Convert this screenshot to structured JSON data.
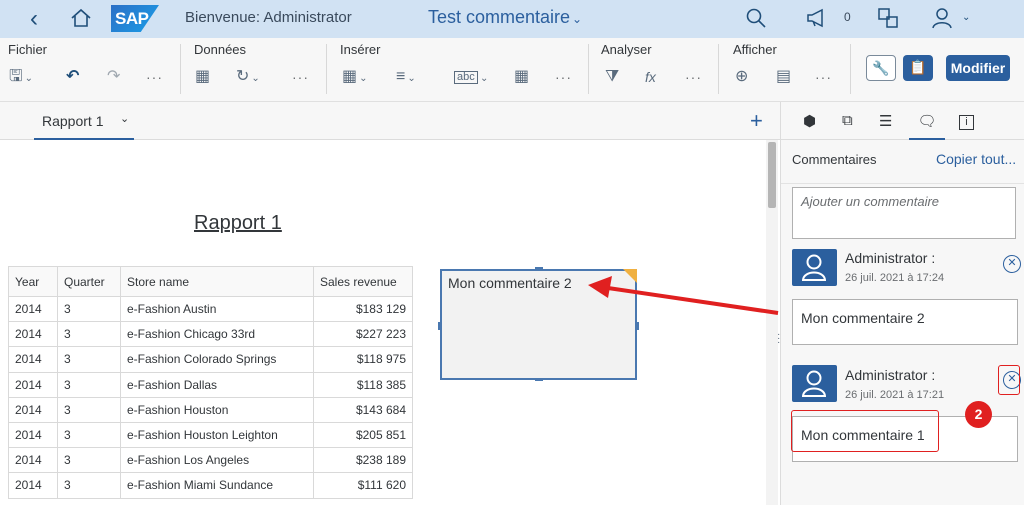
{
  "shell": {
    "welcome": "Bienvenue: Administrator",
    "title": "Test commentaire",
    "logo": "SAP",
    "notif_count": "0"
  },
  "toolbar": {
    "groups": [
      "Fichier",
      "Données",
      "Insérer",
      "Analyser",
      "Afficher"
    ],
    "modify_label": "Modifier"
  },
  "tabs": {
    "report_tab": "Rapport 1"
  },
  "report": {
    "title": "Rapport 1",
    "columns": [
      "Year",
      "Quarter",
      "Store name",
      "Sales revenue"
    ],
    "rows": [
      [
        "2014",
        "3",
        "e-Fashion Austin",
        "$183 129"
      ],
      [
        "2014",
        "3",
        "e-Fashion Chicago 33rd",
        "$227 223"
      ],
      [
        "2014",
        "3",
        "e-Fashion Colorado Springs",
        "$118 975"
      ],
      [
        "2014",
        "3",
        "e-Fashion Dallas",
        "$118 385"
      ],
      [
        "2014",
        "3",
        "e-Fashion Houston",
        "$143 684"
      ],
      [
        "2014",
        "3",
        "e-Fashion Houston Leighton",
        "$205 851"
      ],
      [
        "2014",
        "3",
        "e-Fashion Los Angeles",
        "$238 189"
      ],
      [
        "2014",
        "3",
        "e-Fashion Miami Sundance",
        "$111 620"
      ]
    ],
    "comment_box_text": "Mon commentaire 2"
  },
  "side": {
    "header": "Commentaires",
    "copy_all": "Copier tout...",
    "add_placeholder": "Ajouter un commentaire",
    "comments": [
      {
        "author": "Administrator :",
        "date": "26 juil. 2021 à 17:24",
        "text": "Mon commentaire 2"
      },
      {
        "author": "Administrator :",
        "date": "26 juil. 2021 à 17:21",
        "text": "Mon commentaire 1"
      }
    ]
  },
  "annotation": {
    "badge": "2"
  },
  "colors": {
    "shell_bg": "#d1e2f3",
    "brand": "#2b5f9e",
    "annotation_red": "#e02020",
    "comment_flag": "#f0b040"
  }
}
